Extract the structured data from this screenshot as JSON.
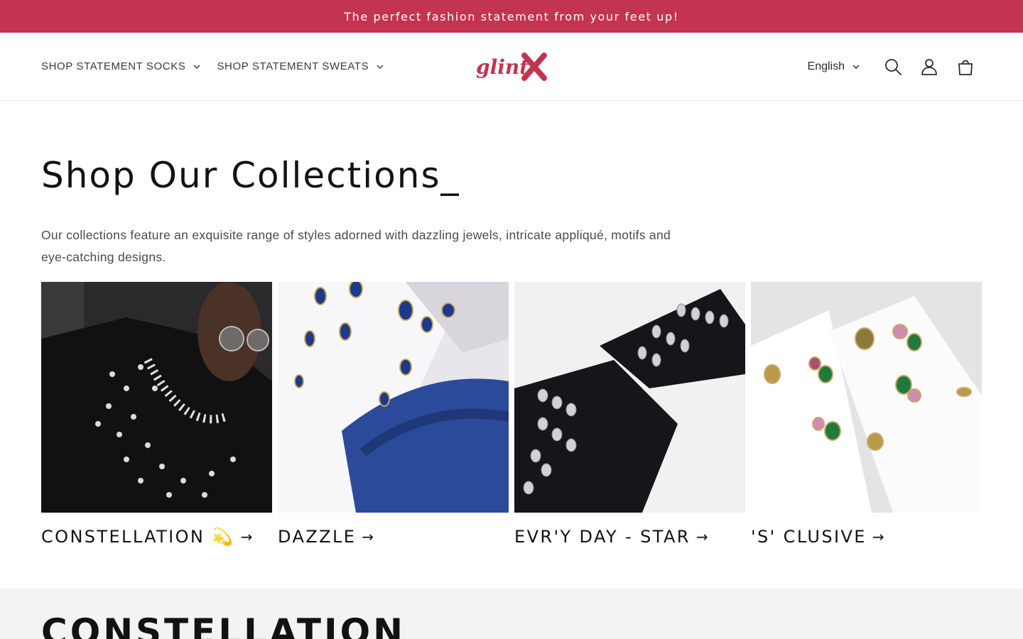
{
  "announcement": {
    "text": "The perfect fashion statement from your feet up!"
  },
  "header": {
    "nav": [
      {
        "label": "SHOP STATEMENT SOCKS"
      },
      {
        "label": "SHOP STATEMENT SWEATS"
      }
    ],
    "logo_text": "glintX",
    "language": "English",
    "icons": [
      "search-icon",
      "account-icon",
      "cart-icon"
    ]
  },
  "main": {
    "title": "Shop Our Collections_",
    "description": "Our collections feature an exquisite range of styles adorned with dazzling jewels, intricate appliqué, motifs and eye-catching designs.",
    "collections": [
      {
        "label": "CONSTELLATION 💫",
        "arrow": "→"
      },
      {
        "label": "DAZZLE",
        "arrow": "→"
      },
      {
        "label": "EVR'Y DAY - STAR",
        "arrow": "→"
      },
      {
        "label": "'S' CLUSIVE",
        "arrow": "→"
      }
    ]
  },
  "next_section": {
    "heading": "CONSTELLATION"
  },
  "colors": {
    "accent": "#c23450",
    "text": "#121212",
    "muted": "#4a4a4a",
    "section_bg": "#f3f3f3"
  }
}
